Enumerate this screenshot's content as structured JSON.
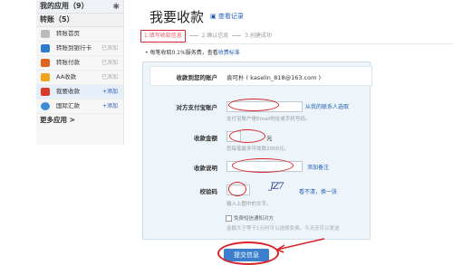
{
  "sidebar": {
    "my_apps": "我的应用（9）",
    "transfer_group": "转账（5）",
    "items": [
      {
        "label": "转账首页",
        "tag": "",
        "icon": "home-icon",
        "color": "#999999"
      },
      {
        "label": "转账到银行卡",
        "tag": "已添加",
        "icon": "bank-card-icon",
        "color": "#2b7bd1"
      },
      {
        "label": "转账付款",
        "tag": "已添加",
        "icon": "pay-icon",
        "color": "#e0641b"
      },
      {
        "label": "AA收款",
        "tag": "已添加",
        "icon": "aa-icon",
        "color": "#f2a31a"
      },
      {
        "label": "我要收款",
        "tag": "+添加",
        "icon": "collect-icon",
        "color": "#d93a2a"
      },
      {
        "label": "国际汇款",
        "tag": "+添加",
        "icon": "globe-icon",
        "color": "#3a8ed8"
      }
    ],
    "more": "更多应用 >"
  },
  "header": {
    "title": "我要收款",
    "view_records": "查看记录"
  },
  "steps": {
    "step1": "1.填写收款信息",
    "step2": "2.确认信息",
    "step3": "3.创建成功"
  },
  "note": {
    "text": "每笔收取0.1%服务费，查看",
    "link": "收费标准"
  },
  "form": {
    "account_label": "收款到您的账户",
    "account_value": "袁可朴 ( kaselin_818@163.com )",
    "payer_label": "对方支付宝账户",
    "payer_link": "从我的联系人选取",
    "payer_hint": "支付宝账户是Email地址或手机号码。",
    "amount_label": "收款金额",
    "amount_unit": "元",
    "amount_hint": "您每笔最多可收款2000元。",
    "reason_label": "收款说明",
    "reason_link": "添加备注",
    "captcha_label": "校验码",
    "captcha_text": "JZ7",
    "captcha_refresh": "看不清，换一张",
    "captcha_hint": "输入上图中的文字。",
    "notify_label": "免费短信通知对方",
    "notify_hint": "金额大于等于1元时可以选择免费。今天还可以发送",
    "submit": "提交信息"
  }
}
